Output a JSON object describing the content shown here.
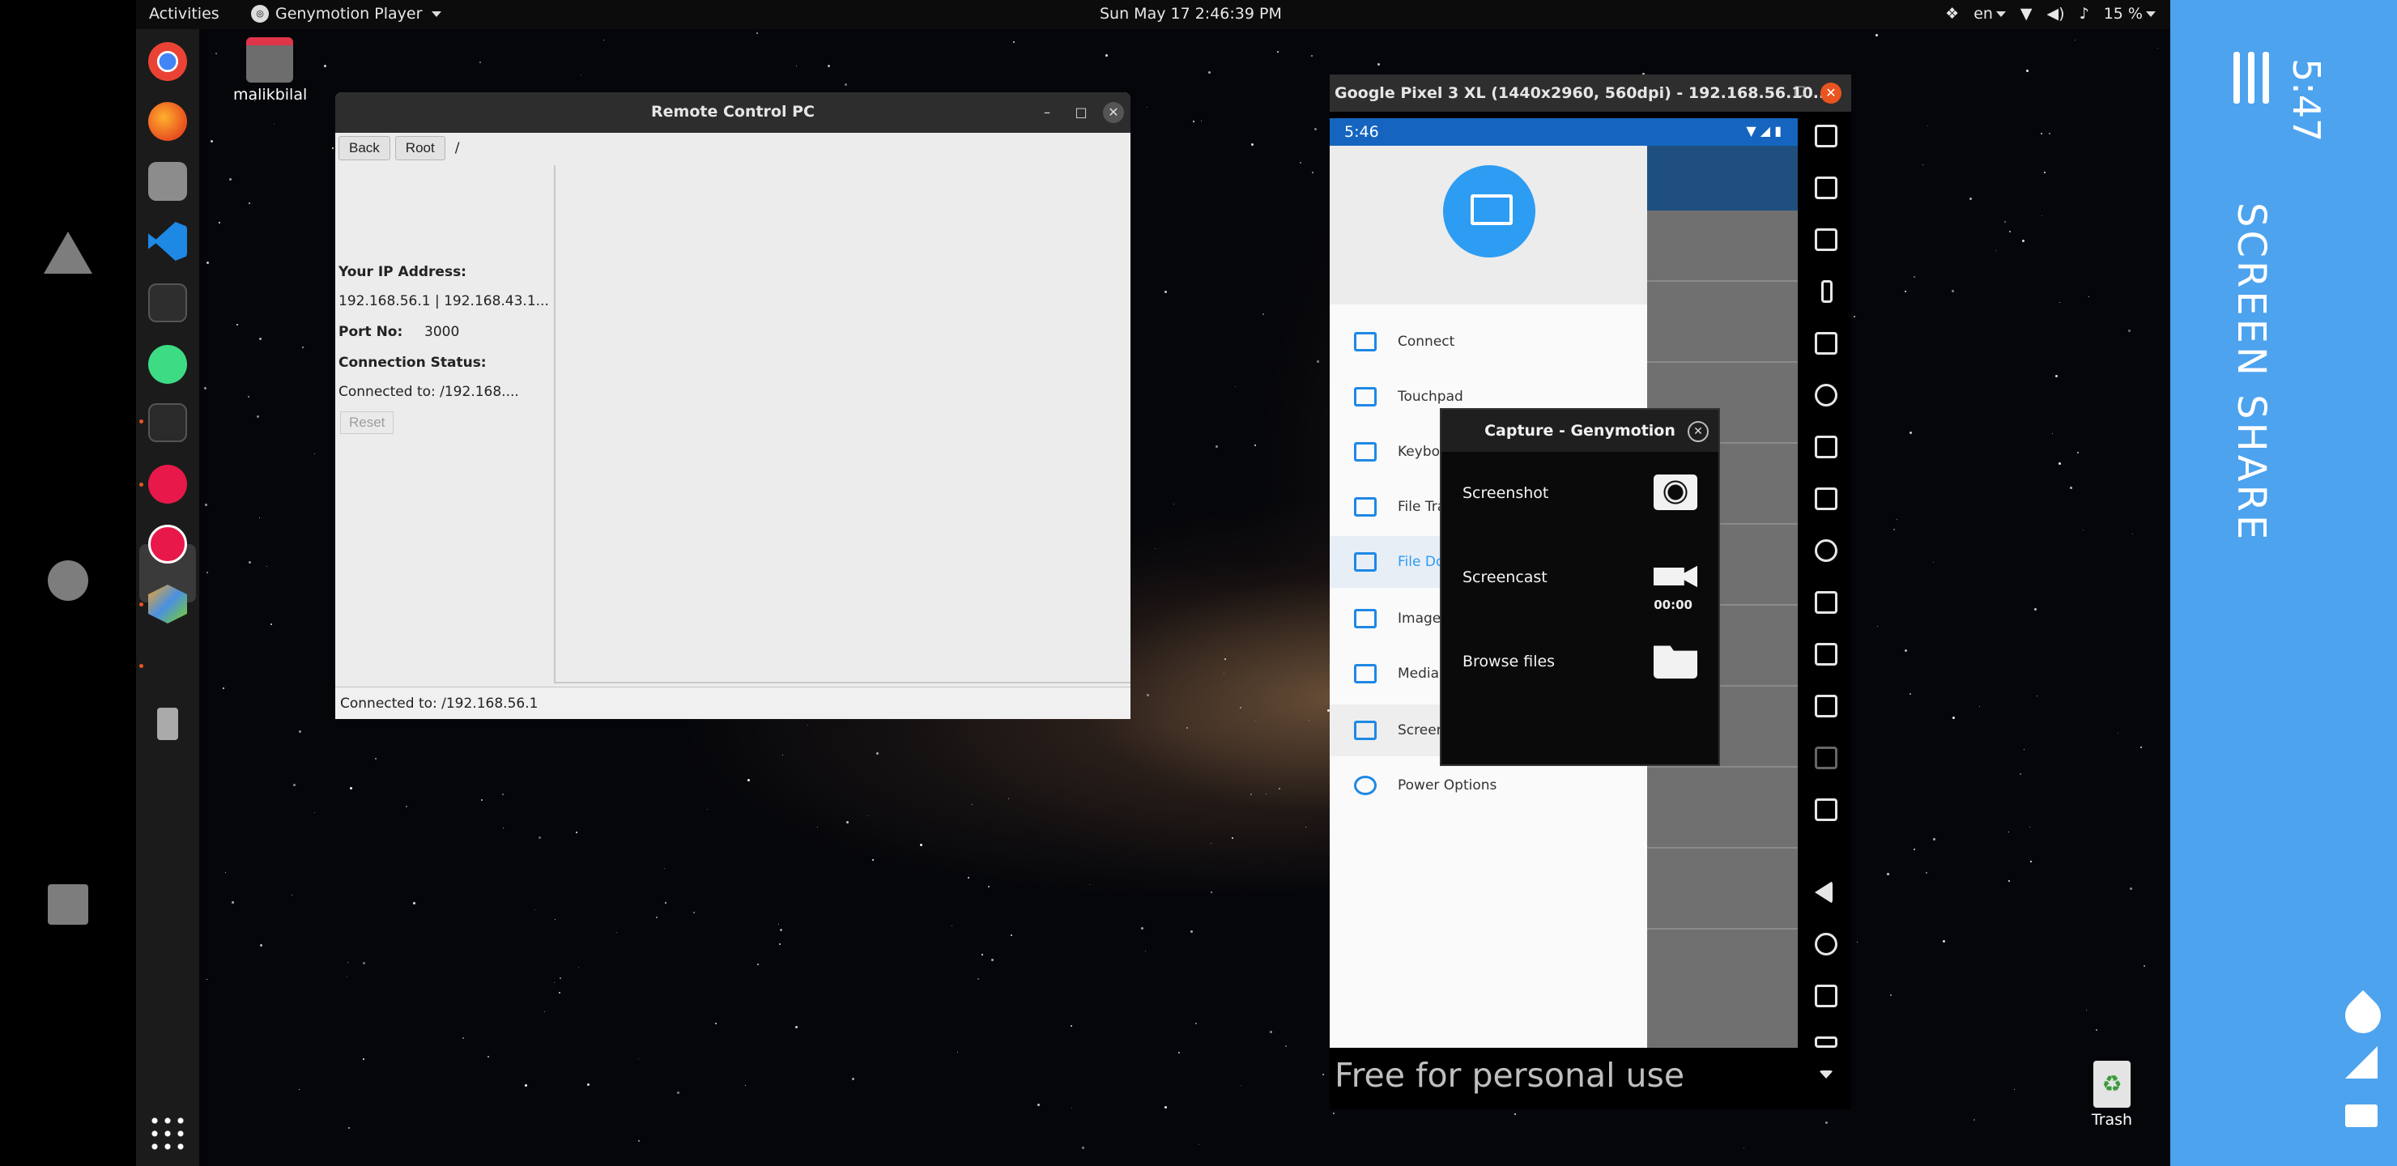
{
  "android": {
    "time": "5:47",
    "app_title": "SCREEN SHARE"
  },
  "topbar": {
    "activities": "Activities",
    "app_name": "Genymotion Player",
    "clock": "Sun May 17  2:46:39 PM",
    "lang": "en",
    "battery": "15 %"
  },
  "desktop": {
    "home_folder_label": "malikbilal",
    "trash_label": "Trash"
  },
  "remote_control": {
    "title": "Remote Control PC",
    "back": "Back",
    "root": "Root",
    "path": "/",
    "ip_label": "Your IP Address:",
    "ip_value": "192.168.56.1 | 192.168.43.1...",
    "port_label": "Port No:",
    "port_value": "3000",
    "status_label": "Connection Status:",
    "status_value": "Connected to: /192.168....",
    "reset": "Reset",
    "statusbar": "Connected to: /192.168.56.1"
  },
  "genymotion": {
    "title": "Google Pixel 3 XL (1440x2960, 560dpi) - 192.168.56.10...",
    "device_time": "5:46",
    "drawer_items": [
      "Connect",
      "Touchpad",
      "Keyboa",
      "File Tra",
      "File Do",
      "Image",
      "Media",
      "Screen",
      "Power Options"
    ],
    "watermark": "Free for personal use"
  },
  "capture": {
    "title": "Capture - Genymotion",
    "screenshot": "Screenshot",
    "screencast": "Screencast",
    "timer": "00:00",
    "browse": "Browse files"
  },
  "colors": {
    "android_accent": "#4da3ee",
    "app_primary": "#1565c0",
    "ubuntu_orange": "#e95420"
  }
}
